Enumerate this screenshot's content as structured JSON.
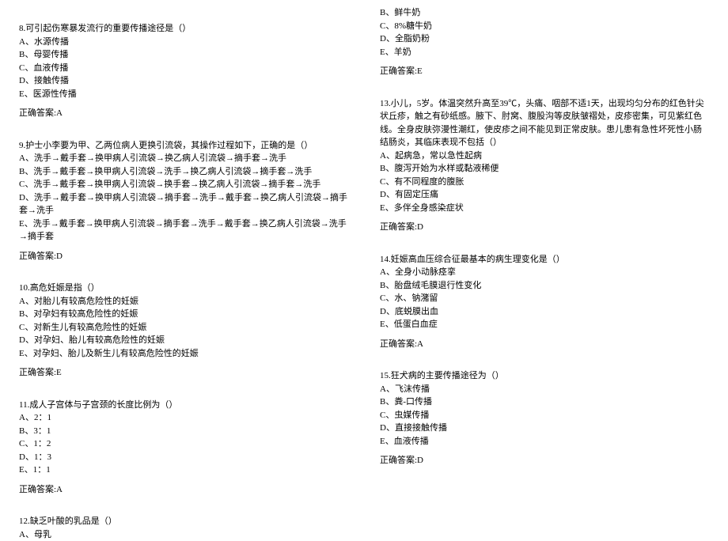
{
  "left": {
    "q8": {
      "stem": "8.可引起伤寒暴发流行的重要传播途径是（）",
      "a": "A、水源传播",
      "b": "B、母婴传播",
      "c": "C、血液传播",
      "d": "D、接触传播",
      "e": "E、医源性传播",
      "ans": "正确答案:A"
    },
    "q9": {
      "stem": "9.护士小李要为甲、乙两位病人更换引流袋，其操作过程如下，正确的是（）",
      "a": "A、洗手→戴手套→换甲病人引流袋→换乙病人引流袋→摘手套→洗手",
      "b": "B、洗手→戴手套→换甲病人引流袋→洗手→换乙病人引流袋→摘手套→洗手",
      "c": "C、洗手→戴手套→换甲病人引流袋→换手套→换乙病人引流袋→摘手套→洗手",
      "d": "D、洗手→戴手套→换甲病人引流袋→摘手套→洗手→戴手套→换乙病人引流袋→摘手套→洗手",
      "e": "E、洗手→戴手套→换甲病人引流袋→摘手套→洗手→戴手套→换乙病人引流袋→洗手→摘手套",
      "ans": "正确答案:D"
    },
    "q10": {
      "stem": "10.高危妊娠是指（）",
      "a": "A、对胎儿有较高危险性的妊娠",
      "b": "B、对孕妇有较高危险性的妊娠",
      "c": "C、对新生儿有较高危险性的妊娠",
      "d": "D、对孕妇、胎儿有较高危险性的妊娠",
      "e": "E、对孕妇、胎儿及新生儿有较高危险性的妊娠",
      "ans": "正确答案:E"
    },
    "q11": {
      "stem": "11.成人子宫体与子宫颈的长度比例为（）",
      "a": "A、2：1",
      "b": "B、3：1",
      "c": "C、1：2",
      "d": "D、1：3",
      "e": "E、1：1",
      "ans": "正确答案:A"
    },
    "q12": {
      "stem": "12.缺乏叶酸的乳品是（）",
      "a": "A、母乳"
    }
  },
  "right": {
    "q12_cont": {
      "b": "B、鲜牛奶",
      "c": "C、8%糖牛奶",
      "d": "D、全脂奶粉",
      "e": "E、羊奶",
      "ans": "正确答案:E"
    },
    "q13": {
      "stem": "13.小儿，5岁。体温突然升高至39℃，头痛、咽部不适1天，出现均匀分布的红色针尖状丘疹，触之有砂纸感。腋下、肘窝、腹股沟等皮肤皱褶处，皮疹密集，可见紫红色线。全身皮肤弥漫性潮红，使皮疹之间不能见到正常皮肤。患儿患有急性坏死性小肠结肠炎，其临床表现不包括（）",
      "a": "A、起病急，常以急性起病",
      "b": "B、腹泻开始为水样或黏液稀便",
      "c": "C、有不同程度的腹胀",
      "d": "D、有固定压痛",
      "e": "E、多伴全身感染症状",
      "ans": "正确答案:D"
    },
    "q14": {
      "stem": "14.妊娠高血压综合征最基本的病生理变化是（）",
      "a": "A、全身小动脉痉挛",
      "b": "B、胎盘绒毛膜退行性变化",
      "c": "C、水、钠潴留",
      "d": "D、底蜕膜出血",
      "e": "E、低蛋白血症",
      "ans": "正确答案:A"
    },
    "q15": {
      "stem": "15.狂犬病的主要传播途径为（）",
      "a": "A、飞沫传播",
      "b": "B、粪-口传播",
      "c": "C、虫媒传播",
      "d": "D、直接接触传播",
      "e": "E、血液传播",
      "ans": "正确答案:D"
    }
  }
}
